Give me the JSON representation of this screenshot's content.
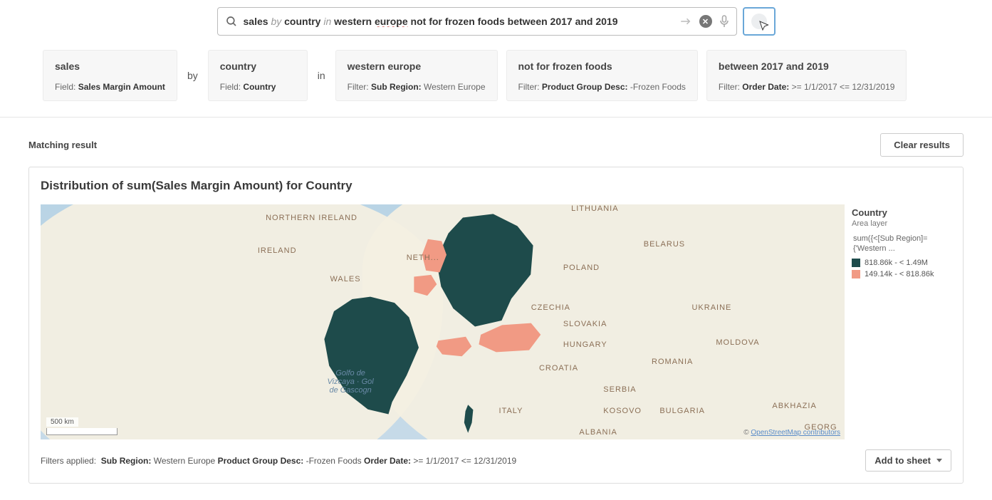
{
  "search": {
    "parts": {
      "p1": "sales",
      "p2": "by",
      "p3": "country",
      "p4": "in",
      "p5": "western",
      "p6": "europe",
      "p7": "not for frozen foods between 2017 and 2019"
    }
  },
  "connectors": {
    "by": "by",
    "in": "in"
  },
  "tokens": {
    "t1": {
      "title": "sales",
      "label": "Field:",
      "value": "Sales Margin Amount"
    },
    "t2": {
      "title": "country",
      "label": "Field:",
      "value": "Country"
    },
    "t3": {
      "title": "western europe",
      "label": "Filter:",
      "field": "Sub Region:",
      "value": "Western Europe"
    },
    "t4": {
      "title": "not for frozen foods",
      "label": "Filter:",
      "field": "Product Group Desc:",
      "value": "-Frozen Foods"
    },
    "t5": {
      "title": "between 2017 and 2019",
      "label": "Filter:",
      "field": "Order Date:",
      "value": ">= 1/1/2017 <= 12/31/2019"
    }
  },
  "headers": {
    "matching": "Matching result",
    "clear": "Clear results",
    "card_title": "Distribution of sum(Sales Margin Amount) for Country",
    "add_to_sheet": "Add to sheet"
  },
  "legend": {
    "title": "Country",
    "subtitle": "Area layer",
    "measure": "sum({<[Sub Region]={'Western ...",
    "bucket1": "818.86k - < 1.49M",
    "bucket2": "149.14k - < 818.86k",
    "color1": "#1e4b4b",
    "color2": "#f19a84"
  },
  "map_labels": {
    "northern_ireland": "NORTHERN IRELAND",
    "ireland": "IRELAND",
    "wales": "WALES",
    "netherlands": "NETH...",
    "poland": "POLAND",
    "lithuania": "LITHUANIA",
    "belarus": "BELARUS",
    "ukraine": "UKRAINE",
    "moldova": "MOLDOVA",
    "czechia": "CZECHIA",
    "slovakia": "SLOVAKIA",
    "hungary": "HUNGARY",
    "romania": "ROMANIA",
    "croatia": "CROATIA",
    "serbia": "SERBIA",
    "kosovo": "KOSOVO",
    "bulgaria": "BULGARIA",
    "albania": "ALBANIA",
    "italy": "ITALY",
    "abkhazia": "ABKHAZIA",
    "georgia": "GEORG",
    "golfo": "Golfo de Vizcaya · Gol de Gascogn",
    "scale": "500 km",
    "attribution_prefix": "© ",
    "attribution_link": "OpenStreetMap contributors"
  },
  "footer": {
    "prefix": "Filters applied:",
    "f1l": "Sub Region:",
    "f1v": "Western Europe",
    "f2l": "Product Group Desc:",
    "f2v": "-Frozen Foods",
    "f3l": "Order Date:",
    "f3v": ">= 1/1/2017 <= 12/31/2019"
  },
  "chart_data": {
    "type": "map-choropleth",
    "dimension": "Country",
    "measure": "sum(Sales Margin Amount)",
    "filters": {
      "Sub Region": "Western Europe",
      "Product Group Desc": "-Frozen Foods",
      "Order Date": ">= 1/1/2017 <= 12/31/2019"
    },
    "buckets": [
      {
        "label": "818.86k - < 1.49M",
        "min": 818860,
        "max": 1490000,
        "color": "#1e4b4b",
        "countries": [
          "France",
          "Germany"
        ]
      },
      {
        "label": "149.14k - < 818.86k",
        "min": 149140,
        "max": 818860,
        "color": "#f19a84",
        "countries": [
          "Netherlands",
          "Belgium",
          "Switzerland",
          "Austria"
        ]
      }
    ]
  }
}
